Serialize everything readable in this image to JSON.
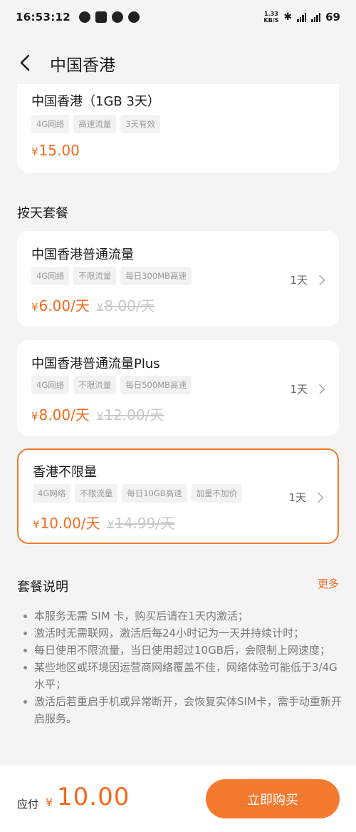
{
  "status_bar": {
    "time": "16:53:12",
    "speed_top": "1.33",
    "speed_bottom": "KB/S",
    "battery": "69",
    "icons": [
      "weibo-icon",
      "notification-icon",
      "drop-icon",
      "chat-icon"
    ]
  },
  "nav": {
    "title": "中国香港"
  },
  "top_card": {
    "name": "中国香港（1GB 3天）",
    "tags": [
      "4G网络",
      "高速流量",
      "3天有效"
    ],
    "price_symbol": "¥",
    "price": "15.00"
  },
  "section_daily": {
    "title": "按天套餐"
  },
  "plans": [
    {
      "name": "中国香港普通流量",
      "tags": [
        "4G网络",
        "不限流量",
        "每日300MB高速"
      ],
      "price_symbol": "¥",
      "price": "6.00/天",
      "original_symbol": "¥",
      "original_price": "8.00/天",
      "duration": "1天",
      "selected": false
    },
    {
      "name": "中国香港普通流量Plus",
      "tags": [
        "4G网络",
        "不限流量",
        "每日500MB高速"
      ],
      "price_symbol": "¥",
      "price": "8.00/天",
      "original_symbol": "¥",
      "original_price": "12.00/天",
      "duration": "1天",
      "selected": false
    },
    {
      "name": "香港不限量",
      "tags": [
        "4G网络",
        "不限流量",
        "每日10GB高速",
        "加量不加价"
      ],
      "price_symbol": "¥",
      "price": "10.00/天",
      "original_symbol": "¥",
      "original_price": "14.99/天",
      "duration": "1天",
      "selected": true
    }
  ],
  "description": {
    "title": "套餐说明",
    "more": "更多",
    "items": [
      "本服务无需 SIM 卡，购买后请在1天内激活；",
      "激活时无需联网，激活后每24小时记为一天并持续计时；",
      "每日使用不限流量，当日使用超过10GB后，会限制上网速度；",
      "某些地区或环境因运营商网络覆盖不佳，网络体验可能低于3/4G 水平；",
      "激活后若重启手机或异常断开，会恢复实体SIM卡，需手动重新开启服务。"
    ]
  },
  "footer": {
    "pay_label": "应付",
    "currency": "¥",
    "amount": "10.00",
    "buy_label": "立即购买"
  },
  "colors": {
    "accent": "#f26a1b",
    "button": "#f47a30",
    "background": "#f4f4f4"
  }
}
